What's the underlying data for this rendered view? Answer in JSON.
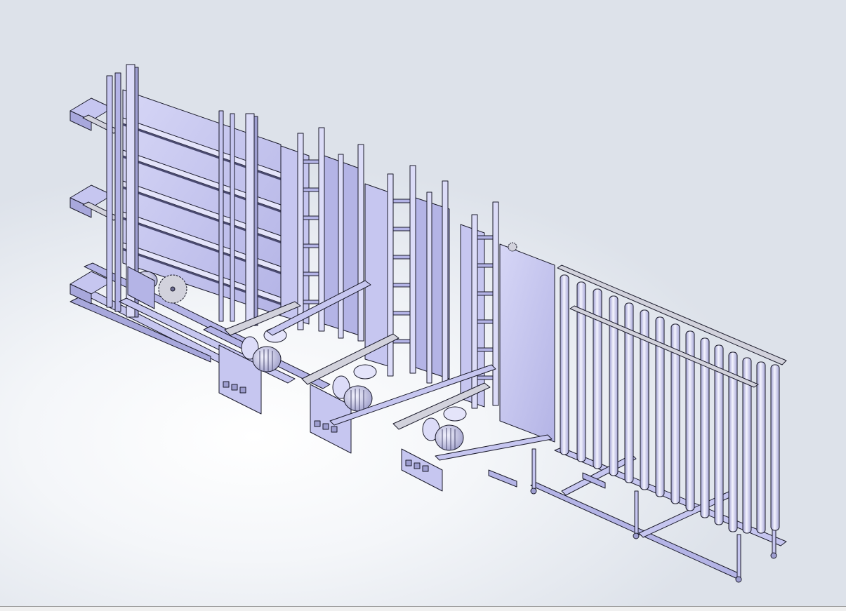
{
  "app": {
    "kind": "cad-graphics-area"
  },
  "model": {
    "icon": "machine-assembly-icon",
    "colors": {
      "part_fill": "#c6c6f0",
      "part_fill_dark": "#a8a8dc",
      "part_fill_light": "#dcdcf8",
      "edge": "#1a1a2a",
      "steel": "#d2d2dc",
      "background_top": "#dde2ea",
      "background_center": "#ffffff"
    }
  }
}
